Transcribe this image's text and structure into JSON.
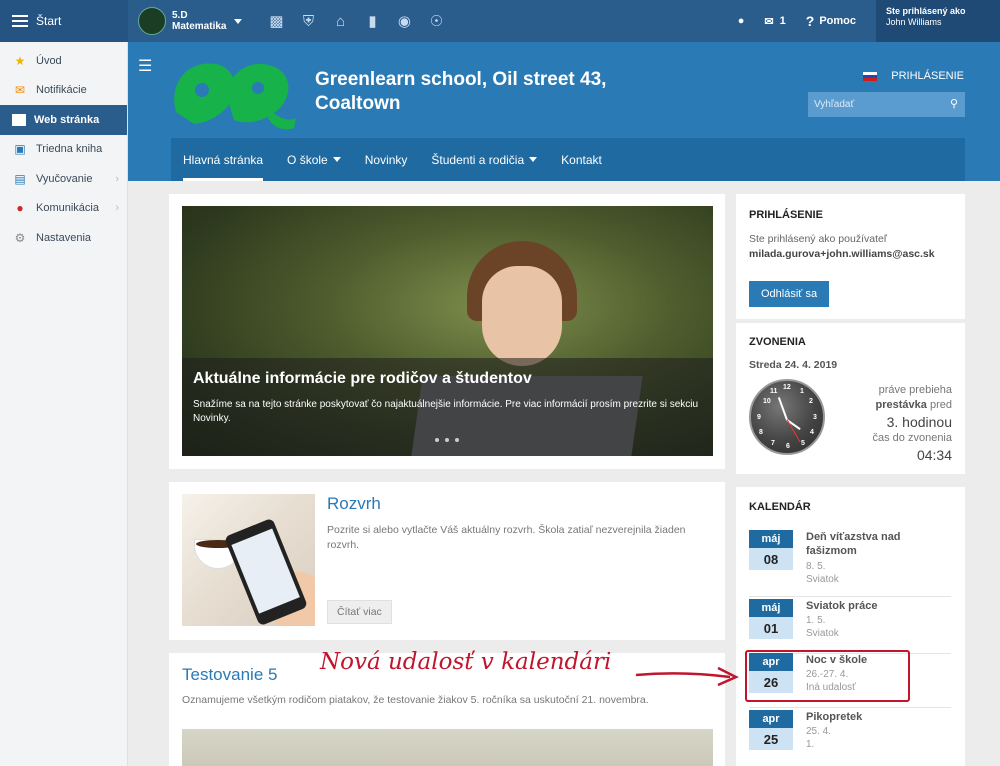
{
  "topbar": {
    "start_label": "Štart",
    "class_line1": "5.D",
    "class_line2": "Matematika",
    "icons": [
      "briefcase-icon",
      "shield-icon",
      "bank-icon",
      "bar-chart-icon",
      "palette-icon",
      "walk-icon"
    ],
    "messages_count": "1",
    "help_label": "Pomoc",
    "user_line1": "Ste prihlásený ako",
    "user_line2": "John Williams"
  },
  "sidebar": {
    "items": [
      {
        "label": "Úvod",
        "icon": "star-icon"
      },
      {
        "label": "Notifikácie",
        "icon": "envelope-icon"
      },
      {
        "label": "Web stránka",
        "icon": "home-icon"
      },
      {
        "label": "Triedna kniha",
        "icon": "book-icon"
      },
      {
        "label": "Vyučovanie",
        "icon": "open-book-icon"
      },
      {
        "label": "Komunikácia",
        "icon": "chat-icon"
      },
      {
        "label": "Nastavenia",
        "icon": "gear-icon"
      }
    ]
  },
  "site": {
    "school_name": "Greenlearn school, Oil street 43, Coaltown",
    "login_link": "PRIHLÁSENIE",
    "search_placeholder": "Vyhľadať",
    "nav": [
      "Hlavná stránka",
      "O škole",
      "Novinky",
      "Študenti a rodičia",
      "Kontakt"
    ]
  },
  "slider": {
    "title": "Aktuálne informácie pre rodičov a študentov",
    "text": "Snažíme sa na tejto stránke poskytovať čo najaktuálnejšie informácie. Pre viac informácií prosím prezrite si sekciu Novinky."
  },
  "rozvrh": {
    "title": "Rozvrh",
    "text": "Pozrite si alebo vytlačte Váš aktuálny rozvrh. Škola zatiaľ nezverejnila žiaden rozvrh.",
    "more": "Čítať viac"
  },
  "testovanie": {
    "title": "Testovanie 5",
    "text": "Oznamujeme všetkým rodičom piatakov, že testovanie žiakov 5. ročníka sa uskutoční 21. novembra."
  },
  "login_box": {
    "title": "PRIHLÁSENIE",
    "line1": "Ste prihlásený ako používateľ",
    "email": "milada.gurova+john.williams@asc.sk",
    "logout": "Odhlásiť sa"
  },
  "bells": {
    "title": "ZVONENIA",
    "date": "Streda 24. 4. 2019",
    "now": "práve prebieha",
    "state": "prestávka",
    "before": "pred",
    "lesson": "3. hodinou",
    "countdown_label": "čas do zvonenia",
    "countdown": "04:34"
  },
  "calendar": {
    "title": "KALENDÁR",
    "events": [
      {
        "month": "máj",
        "day": "08",
        "name": "Deň víťazstva nad fašizmom",
        "date": "8. 5.",
        "type": "Sviatok"
      },
      {
        "month": "máj",
        "day": "01",
        "name": "Sviatok práce",
        "date": "1. 5.",
        "type": "Sviatok"
      },
      {
        "month": "apr",
        "day": "26",
        "name": "Noc v škole",
        "date": "26.-27. 4.",
        "type": "Iná udalosť"
      },
      {
        "month": "apr",
        "day": "25",
        "name": "Pikopretek",
        "date": "25. 4.",
        "type": "1."
      }
    ]
  },
  "annotation": "Nová udalosť v kalendári",
  "colors": {
    "accent": "#2a7ab5",
    "topbar": "#2a5c8c",
    "annotation": "#c0152d"
  }
}
